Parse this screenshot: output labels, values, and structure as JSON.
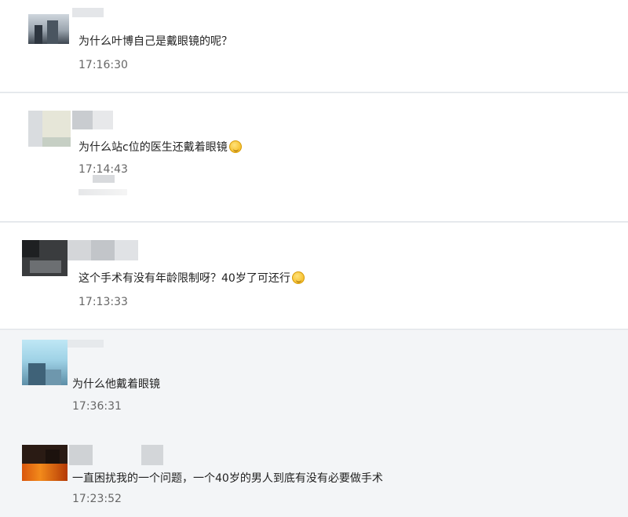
{
  "comments": [
    {
      "text": "为什么叶博自己是戴眼镜的呢？",
      "time": "17:16:30",
      "emoji": ""
    },
    {
      "text": "为什么站c位的医生还戴着眼镜",
      "time": "17:14:43",
      "emoji": "thinking-face-icon"
    },
    {
      "text": "这个手术有没有年龄限制呀？40岁了可还行",
      "time": "17:13:33",
      "emoji": "grinning-face-icon"
    },
    {
      "text": "为什么他戴着眼镜",
      "time": "17:36:31",
      "emoji": ""
    },
    {
      "text": "一直困扰我的一个问题，一个40岁的男人到底有没有必要做手术",
      "time": "17:23:52",
      "emoji": ""
    }
  ],
  "colors": {
    "card_bg": "#ffffff",
    "alt_bg": "#f3f5f7",
    "text": "#222222",
    "time": "#666666",
    "emoji": "#f2b20f"
  }
}
